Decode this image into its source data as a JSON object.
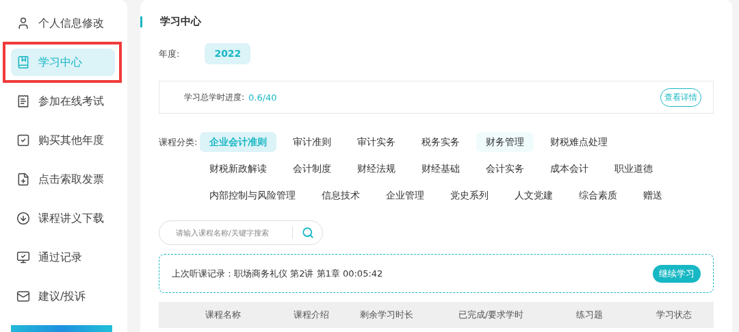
{
  "sidebar": {
    "items": [
      {
        "label": "个人信息修改",
        "selected": false,
        "annotated": false
      },
      {
        "label": "学习中心",
        "selected": true,
        "annotated": true
      },
      {
        "label": "参加在线考试",
        "selected": false,
        "annotated": false
      },
      {
        "label": "购买其他年度",
        "selected": false,
        "annotated": false
      },
      {
        "label": "点击索取发票",
        "selected": false,
        "annotated": false
      },
      {
        "label": "课程讲义下载",
        "selected": false,
        "annotated": false
      },
      {
        "label": "通过记录",
        "selected": false,
        "annotated": false
      },
      {
        "label": "建议/投诉",
        "selected": false,
        "annotated": false
      }
    ]
  },
  "main": {
    "title": "学习中心",
    "year": {
      "label": "年度:",
      "options": [
        {
          "label": "2022",
          "selected": true
        }
      ]
    },
    "progress": {
      "label": "学习总学时进度:",
      "value": "0.6/40",
      "button": "查看详情"
    },
    "categories": {
      "label": "课程分类:",
      "rows": [
        [
          {
            "label": "企业会计准则",
            "selected": true,
            "highlighted": false
          },
          {
            "label": "审计准则",
            "selected": false,
            "highlighted": false
          },
          {
            "label": "审计实务",
            "selected": false,
            "highlighted": false
          },
          {
            "label": "税务实务",
            "selected": false,
            "highlighted": false
          },
          {
            "label": "财务管理",
            "selected": false,
            "highlighted": true
          },
          {
            "label": "财税难点处理",
            "selected": false,
            "highlighted": false
          }
        ],
        [
          {
            "label": "财税新政解读",
            "selected": false,
            "highlighted": false
          },
          {
            "label": "会计制度",
            "selected": false,
            "highlighted": false
          },
          {
            "label": "财经法规",
            "selected": false,
            "highlighted": false
          },
          {
            "label": "财经基础",
            "selected": false,
            "highlighted": false
          },
          {
            "label": "会计实务",
            "selected": false,
            "highlighted": false
          },
          {
            "label": "成本会计",
            "selected": false,
            "highlighted": false
          },
          {
            "label": "职业道德",
            "selected": false,
            "highlighted": false
          }
        ],
        [
          {
            "label": "内部控制与风险管理",
            "selected": false,
            "highlighted": false
          },
          {
            "label": "信息技术",
            "selected": false,
            "highlighted": false
          },
          {
            "label": "企业管理",
            "selected": false,
            "highlighted": false
          },
          {
            "label": "党史系列",
            "selected": false,
            "highlighted": false
          },
          {
            "label": "人文党建",
            "selected": false,
            "highlighted": false
          },
          {
            "label": "综合素质",
            "selected": false,
            "highlighted": false
          },
          {
            "label": "赠送",
            "selected": false,
            "highlighted": false
          }
        ]
      ]
    },
    "search": {
      "placeholder": "请输入课程名称/关键字搜索"
    },
    "last_record": {
      "text": "上次听课记录：职场商务礼仪 第2讲 第1章 00:05:42",
      "button": "继续学习"
    },
    "table": {
      "columns": [
        "课程名称",
        "课程介绍",
        "剩余学习时长",
        "已完成/要求学时",
        "练习题",
        "学习状态"
      ]
    }
  }
}
